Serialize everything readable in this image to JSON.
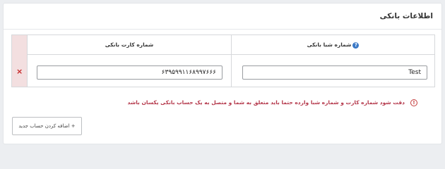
{
  "panel": {
    "title": "اطلاعات بانکی"
  },
  "table": {
    "headers": {
      "sheba": "شماره شبا بانکی",
      "card": "شماره کارت بانکی"
    },
    "rows": [
      {
        "sheba": "Test",
        "card": "۶۳۹۵۹۹۱۱۶۸۹۹۷۶۶۶"
      }
    ]
  },
  "icons": {
    "help": "?",
    "remove": "×",
    "warning": "!"
  },
  "warning": {
    "text": "دقت شود شماره کارت و شماره شبا وارده حتما باید متعلق به شما و متصل به یک حساب بانکی یکسان باشد"
  },
  "add_button": {
    "label": "+ اضافه کردن حساب جدید"
  },
  "colors": {
    "error": "#c62828",
    "warning_text": "#b4374a",
    "help": "#3a78c6",
    "remove_cell_bg": "#f3dfe0"
  }
}
